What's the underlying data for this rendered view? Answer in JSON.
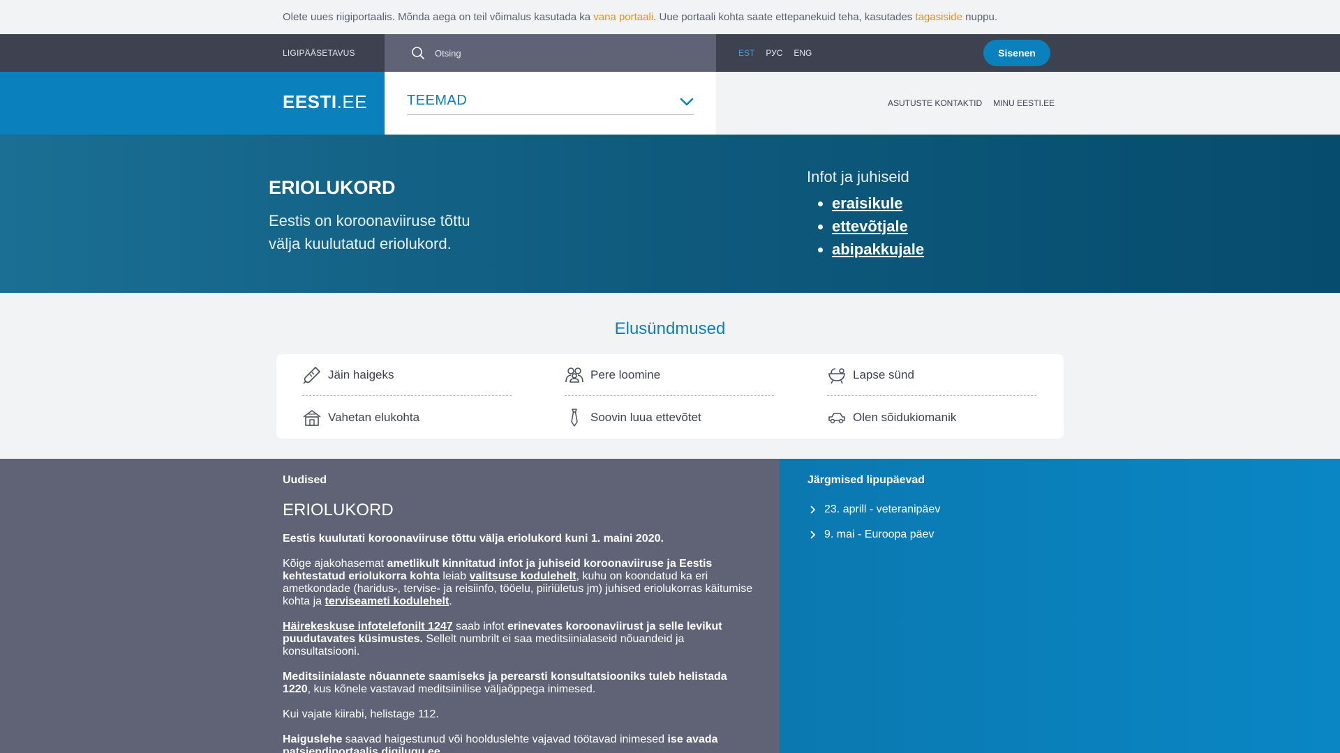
{
  "notice": {
    "part1": "Olete uues riigiportaalis. Mõnda aega on teil võimalus kasutada ka ",
    "link1": "vana portaali",
    "part2": ". Uue portaali kohta saate ettepanekuid teha, kasutades ",
    "link2": "tagasiside",
    "part3": " nuppu."
  },
  "topbar": {
    "accessibility": "LIGIPÄÄSETAVUS",
    "search_placeholder": "Otsing",
    "languages": [
      "EST",
      "РУС",
      "ENG"
    ],
    "active_language": "EST",
    "login": "Sisenen"
  },
  "navbar": {
    "logo_bold": "EESTI",
    "logo_rest": ".EE",
    "themes": "TEEMAD",
    "links": [
      "ASUTUSTE KONTAKTID",
      "MINU EESTI.EE"
    ]
  },
  "hero": {
    "title": "ERIOLUKORD",
    "subtitle": "Eestis on koroonaviiruse tõttu välja kuulutatud eriolukord.",
    "info_title": "Infot ja juhiseid",
    "info_links": [
      "eraisikule",
      "ettevõtjale",
      "abipakkujale"
    ]
  },
  "events": {
    "title": "Elusündmused",
    "items": [
      {
        "label": "Jäin haigeks",
        "icon": "thermometer-icon"
      },
      {
        "label": "Pere loomine",
        "icon": "family-icon"
      },
      {
        "label": "Lapse sünd",
        "icon": "baby-bath-icon"
      },
      {
        "label": "Vahetan elukohta",
        "icon": "house-icon"
      },
      {
        "label": "Soovin luua ettevõtet",
        "icon": "tie-icon"
      },
      {
        "label": "Olen sõidukiomanik",
        "icon": "car-icon"
      }
    ]
  },
  "news": {
    "heading": "Uudised",
    "title": "ERIOLUKORD",
    "p1": "Eestis kuulutati koroonaviiruse tõttu välja eriolukord kuni 1. maini 2020.",
    "p2a": "Kõige ajakohasemat ",
    "p2b": "ametlikult kinnitatud infot ja juhiseid koroonaviiruse ja Eestis kehtestatud eriolukorra kohta",
    "p2c": " leiab ",
    "p2link1": "valitsuse kodulehelt",
    "p2d": ", kuhu on koondatud ka eri ametkondade (haridus-, tervise- ja reisiinfo, tööelu, piiriületus jm) juhised eriolukorras käitumise kohta ja ",
    "p2link2": "terviseameti kodulehelt",
    "p2e": ".",
    "p3link": "Häirekeskuse infotelefonilt 1247",
    "p3a": " saab infot ",
    "p3b": "erinevates koroonaviirust ja selle levikut puudutavates küsimustes.",
    "p3c": " Sellelt numbrilt ei saa meditsiinialaseid nõuandeid ja konsultatsiooni.",
    "p4a": "Meditsiinialaste nõuannete saamiseks ja perearsti konsultatsiooniks tuleb helistada 1220",
    "p4b": ", kus kõnele vastavad meditsiinilise väljaõppega inimesed.",
    "p5": "Kui vajate kiirabi, helistage 112.",
    "p6a": "Haiguslehe",
    "p6b": " saavad haigestunud või hoolduslehte vajavad töötavad inimesed ",
    "p6c": "ise avada patsiendiportaalis digilugu.ee"
  },
  "flags": {
    "heading": "Järgmised lipupäevad",
    "items": [
      "23. aprill - veteranipäev",
      "9. mai - Euroopa päev"
    ]
  },
  "colors": {
    "brand_blue": "#0a81bd",
    "dark_bar": "#3d4150",
    "orange_link": "#ef8d14",
    "news_bg": "#5f6375"
  }
}
